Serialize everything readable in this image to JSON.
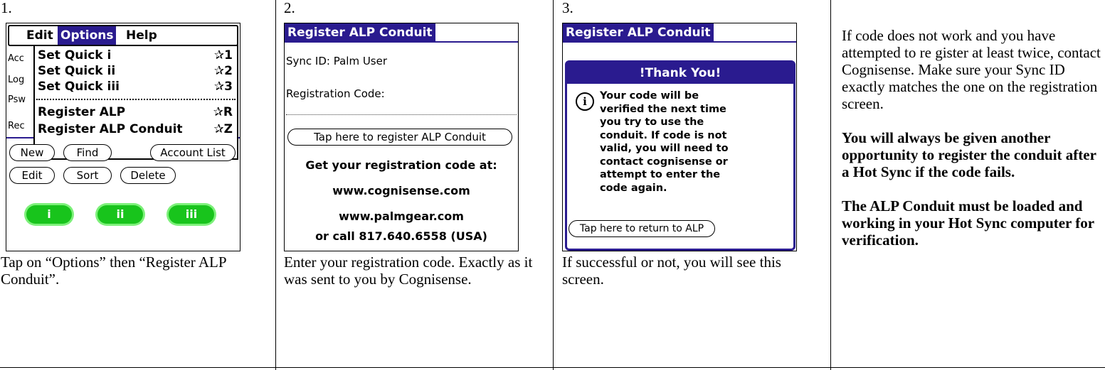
{
  "steps": [
    {
      "num": "1.",
      "caption": "Tap on “Options” then “Register ALP Conduit”."
    },
    {
      "num": "2.",
      "caption": "Enter your registration code. Exactly as it was sent to you by Cognisense."
    },
    {
      "num": "3.",
      "caption": "If successful or not, you will see this screen."
    }
  ],
  "screen1": {
    "menubar": {
      "edit": "Edit",
      "options": "Options",
      "help": "Help"
    },
    "menu_items": [
      {
        "label": "Set Quick i",
        "key": "✰1"
      },
      {
        "label": "Set Quick ii",
        "key": "✰2"
      },
      {
        "label": "Set Quick iii",
        "key": "✰3"
      },
      {
        "label": "Register ALP",
        "key": "✰R"
      },
      {
        "label": "Register ALP Conduit",
        "key": "✰Z"
      }
    ],
    "left_labels": [
      "Acc",
      "Log",
      "Psw",
      "Rec"
    ],
    "buttons": {
      "new": "New",
      "find": "Find",
      "account_list": "Account List",
      "edit": "Edit",
      "sort": "Sort",
      "delete": "Delete"
    },
    "quick": {
      "i": "i",
      "ii": "ii",
      "iii": "iii"
    }
  },
  "screen2": {
    "title": "Register ALP Conduit",
    "sync_id": "Sync ID:  Palm User",
    "reg_code_label": "Registration Code:",
    "tap_button": "Tap here to register ALP Conduit",
    "get_code": "Get your registration code at:",
    "site1": "www.cognisense.com",
    "site2": "www.palmgear.com",
    "call": "or call 817.640.6558 (USA)"
  },
  "screen3": {
    "title": "Register ALP Conduit",
    "dialog_title": "!Thank You!",
    "info_icon_text": "i",
    "message_lines": [
      "Your code will be",
      "verified the next time",
      "you try to use the",
      "conduit.  If code is not",
      "valid, you will need to",
      "contact cognisense or",
      "attempt to enter the",
      "code again."
    ],
    "return_button": "Tap here to return to ALP"
  },
  "notes": {
    "p1": "If code does not work and you have attempted to re gister at least twice, contact Cognisense.  Make sure your Sync ID exactly matches the one on the registration screen.",
    "p2": "You will always be given another opportunity to register the conduit after a Hot Sync if the code fails.",
    "p3": "The ALP Conduit must be loaded and working in your Hot Sync computer for verification."
  },
  "colors": {
    "palm_title": "#2a1b8f",
    "pill_green": "#18c41c"
  }
}
